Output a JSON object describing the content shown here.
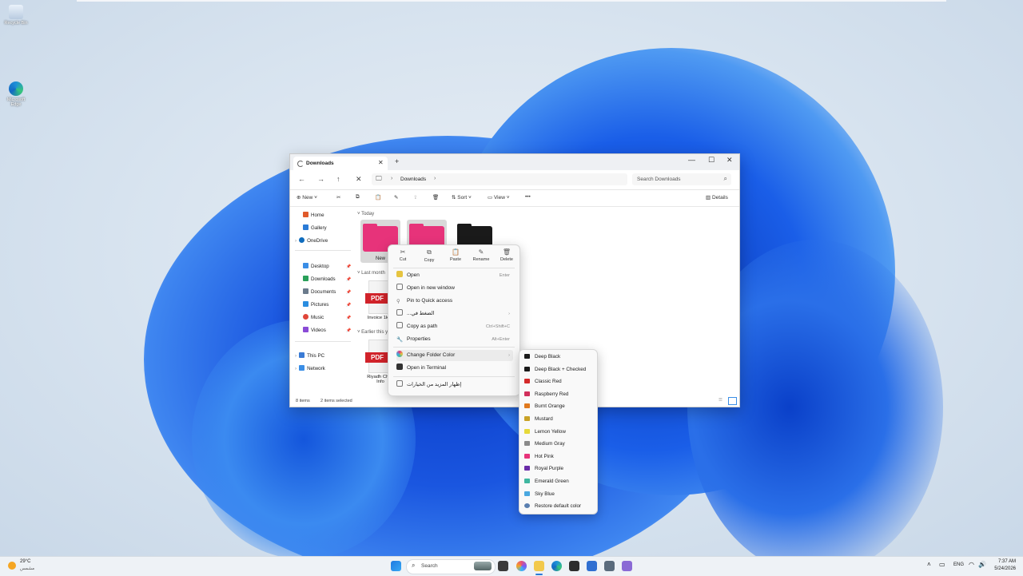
{
  "desktop": {
    "icons": [
      {
        "label": "Recycle Bin",
        "icon": "recycle-bin-icon"
      },
      {
        "label": "Microsoft Edge",
        "icon": "edge-icon"
      }
    ]
  },
  "explorer": {
    "tab_title": "Downloads",
    "breadcrumb": "Downloads",
    "search_placeholder": "Search Downloads",
    "commands": {
      "new": "New",
      "sort": "Sort",
      "view": "View",
      "details": "Details"
    },
    "sidebar": [
      {
        "label": "Home",
        "color": "#e05a2b"
      },
      {
        "label": "Gallery",
        "color": "#2a7bd6"
      },
      {
        "label": "OneDrive",
        "color": "#0f6cbd"
      },
      {
        "label": "Desktop",
        "color": "#3a8ee6"
      },
      {
        "label": "Downloads",
        "color": "#2aa05a"
      },
      {
        "label": "Documents",
        "color": "#6b7b8c"
      },
      {
        "label": "Pictures",
        "color": "#2a8de0"
      },
      {
        "label": "Music",
        "color": "#e0463a"
      },
      {
        "label": "Videos",
        "color": "#8a4bd6"
      },
      {
        "label": "This PC",
        "color": "#3a7bd5"
      },
      {
        "label": "Network",
        "color": "#3a8ee6"
      }
    ],
    "groups": {
      "today": "Today",
      "last_month": "Last month",
      "earlier": "Earlier this ye"
    },
    "files": {
      "folder1": "New",
      "invoice": "Invoice 1kg1",
      "riyadh_line1": "Riyadh Chan",
      "riyadh_line2": "Info",
      "pdf_band": "PDF"
    },
    "status": {
      "count": "8 items",
      "selected": "2 items selected"
    }
  },
  "context_menu": {
    "quick_actions": [
      "Cut",
      "Copy",
      "Paste",
      "Rename",
      "Delete"
    ],
    "items": [
      {
        "label": "Open",
        "shortcut": "Enter"
      },
      {
        "label": "Open in new window",
        "shortcut": ""
      },
      {
        "label": "Pin to Quick access",
        "shortcut": ""
      },
      {
        "label": "...الضغط في",
        "shortcut": ""
      },
      {
        "label": "Copy as path",
        "shortcut": "Ctrl+Shift+C"
      },
      {
        "label": "Properties",
        "shortcut": "Alt+Enter"
      },
      {
        "label": "Change Folder Color",
        "shortcut": ""
      },
      {
        "label": "Open in Terminal",
        "shortcut": ""
      },
      {
        "label": "إظهار المزيد من الخيارات",
        "shortcut": ""
      }
    ]
  },
  "color_submenu": [
    {
      "label": "Deep Black",
      "color": "#1a1a1a"
    },
    {
      "label": "Deep Black + Checked",
      "color": "#1a1a1a"
    },
    {
      "label": "Classic Red",
      "color": "#d42a2a"
    },
    {
      "label": "Raspberry Red",
      "color": "#d12f5b"
    },
    {
      "label": "Burnt Orange",
      "color": "#e07a1e"
    },
    {
      "label": "Mustard",
      "color": "#c9a227"
    },
    {
      "label": "Lemon Yellow",
      "color": "#e6d93a"
    },
    {
      "label": "Medium Gray",
      "color": "#8a8a8a"
    },
    {
      "label": "Hot Pink",
      "color": "#e7337a"
    },
    {
      "label": "Royal Purple",
      "color": "#6a2ca8"
    },
    {
      "label": "Emerald Green",
      "color": "#3fb7a0"
    },
    {
      "label": "Sky Blue",
      "color": "#4aa8e0"
    },
    {
      "label": "Restore default color",
      "color": "#5a7fb0"
    }
  ],
  "taskbar": {
    "weather_temp": "29°C",
    "weather_desc": "مشمس",
    "search_label": "Search",
    "language": "ENG",
    "time": "7:37 AM",
    "date": "5/24/2026"
  }
}
